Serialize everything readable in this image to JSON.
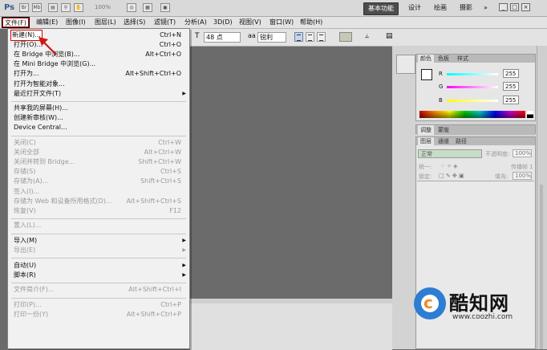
{
  "titlebar": {
    "app_logo": "Ps",
    "zoom": "100%",
    "workspaces": [
      "基本功能",
      "设计",
      "绘画",
      "摄影"
    ],
    "more": "»",
    "min": "_",
    "max": "□",
    "close": "×"
  },
  "menubar": [
    "文件(F)",
    "编辑(E)",
    "图像(I)",
    "图层(L)",
    "选择(S)",
    "滤镜(T)",
    "分析(A)",
    "3D(D)",
    "视图(V)",
    "窗口(W)",
    "帮助(H)"
  ],
  "options": {
    "font_size": "48 点",
    "aa_icon": "aa",
    "antialias": "锐利"
  },
  "file_menu": [
    {
      "label": "新建(N)...",
      "shortcut": "Ctrl+N",
      "highlight": true
    },
    {
      "label": "打开(O)...",
      "shortcut": "Ctrl+O"
    },
    {
      "label": "在 Bridge 中浏览(B)...",
      "shortcut": "Alt+Ctrl+O"
    },
    {
      "label": "在 Mini Bridge 中浏览(G)...",
      "shortcut": ""
    },
    {
      "label": "打开为...",
      "shortcut": "Alt+Shift+Ctrl+O"
    },
    {
      "label": "打开为智能对象...",
      "shortcut": ""
    },
    {
      "label": "最近打开文件(T)",
      "shortcut": "",
      "submenu": true
    },
    {
      "sep": true
    },
    {
      "label": "共享我的屏幕(H)...",
      "shortcut": ""
    },
    {
      "label": "创建新审核(W)...",
      "shortcut": ""
    },
    {
      "label": "Device Central...",
      "shortcut": ""
    },
    {
      "sep": true
    },
    {
      "label": "关闭(C)",
      "shortcut": "Ctrl+W",
      "disabled": true
    },
    {
      "label": "关闭全部",
      "shortcut": "Alt+Ctrl+W",
      "disabled": true
    },
    {
      "label": "关闭并转到 Bridge...",
      "shortcut": "Shift+Ctrl+W",
      "disabled": true
    },
    {
      "label": "存储(S)",
      "shortcut": "Ctrl+S",
      "disabled": true
    },
    {
      "label": "存储为(A)...",
      "shortcut": "Shift+Ctrl+S",
      "disabled": true
    },
    {
      "label": "签入(I)...",
      "shortcut": "",
      "disabled": true
    },
    {
      "label": "存储为 Web 和设备所用格式(D)...",
      "shortcut": "Alt+Shift+Ctrl+S",
      "disabled": true
    },
    {
      "label": "恢复(V)",
      "shortcut": "F12",
      "disabled": true
    },
    {
      "sep": true
    },
    {
      "label": "置入(L)...",
      "shortcut": "",
      "disabled": true
    },
    {
      "sep": true
    },
    {
      "label": "导入(M)",
      "shortcut": "",
      "submenu": true
    },
    {
      "label": "导出(E)",
      "shortcut": "",
      "submenu": true,
      "disabled": true
    },
    {
      "sep": true
    },
    {
      "label": "自动(U)",
      "shortcut": "",
      "submenu": true
    },
    {
      "label": "脚本(R)",
      "shortcut": "",
      "submenu": true
    },
    {
      "sep": true
    },
    {
      "label": "文件简介(F)...",
      "shortcut": "Alt+Shift+Ctrl+I",
      "disabled": true
    },
    {
      "sep": true
    },
    {
      "label": "打印(P)...",
      "shortcut": "Ctrl+P",
      "disabled": true
    },
    {
      "label": "打印一份(Y)",
      "shortcut": "Alt+Shift+Ctrl+P",
      "disabled": true
    }
  ],
  "color_panel": {
    "tabs": [
      "颜色",
      "色板",
      "样式"
    ],
    "channels": [
      {
        "name": "R",
        "value": "255"
      },
      {
        "name": "G",
        "value": "255"
      },
      {
        "name": "B",
        "value": "255"
      }
    ]
  },
  "adjust_tabs": [
    "调整",
    "蒙版"
  ],
  "layers_panel": {
    "tabs": [
      "图层",
      "通道",
      "路径"
    ],
    "blend_mode": "正常",
    "opacity_label": "不透明度:",
    "opacity": "100%",
    "lock_label": "锁定:",
    "fill_label": "填充:",
    "fill": "100%",
    "unify_label": "统一:",
    "propagate_label": "传播帧 1"
  },
  "watermark": {
    "title": "酷知网",
    "url": "www.coozhi.com"
  }
}
